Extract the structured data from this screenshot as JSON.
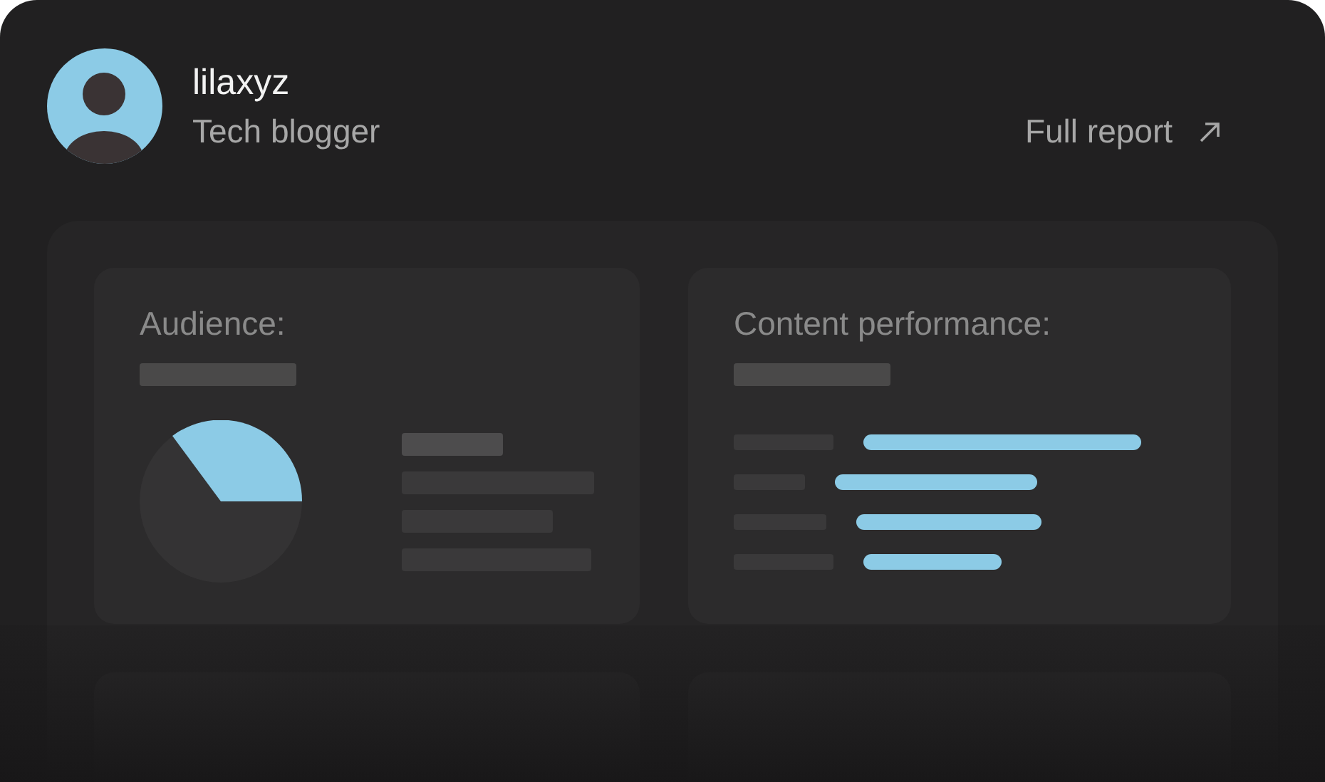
{
  "profile": {
    "username": "lilaxyz",
    "role": "Tech blogger"
  },
  "report_link": {
    "label": "Full report"
  },
  "cards": [
    {
      "kind": "pie",
      "title": "Audience:"
    },
    {
      "kind": "bars",
      "title": "Content performance:"
    }
  ]
}
